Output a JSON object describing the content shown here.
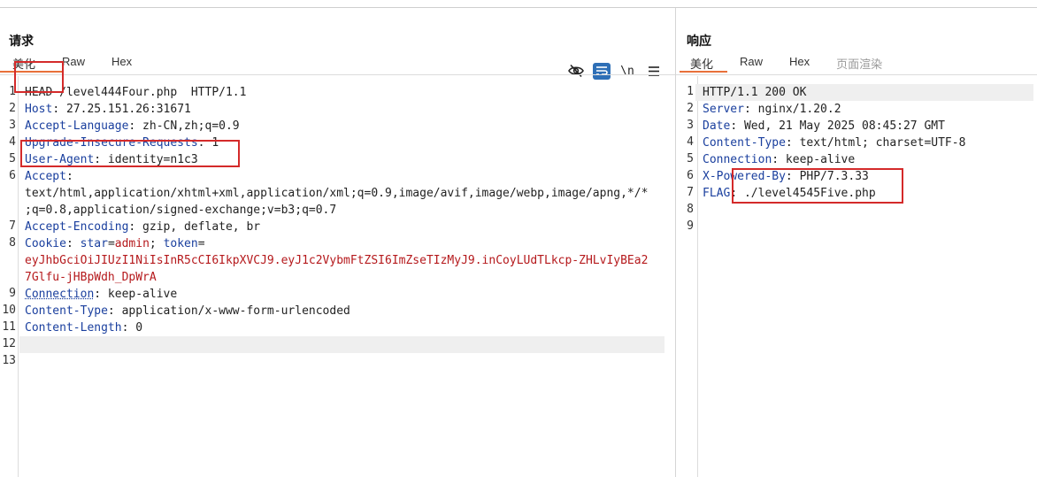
{
  "request": {
    "title": "请求",
    "tabs": [
      "美化",
      "Raw",
      "Hex"
    ],
    "icons": [
      "eye-off-icon",
      "wrap-icon",
      "newline-icon",
      "menu-icon"
    ],
    "newline_label": "\\n",
    "lines": [
      {
        "n": "1",
        "key": "",
        "text": "HEAD /level444Four.php  HTTP/1.1"
      },
      {
        "n": "2",
        "key": "Host",
        "text": ": 27.25.151.26:31671"
      },
      {
        "n": "3",
        "key": "Accept-Language",
        "text": ": zh-CN,zh;q=0.9"
      },
      {
        "n": "4",
        "key": "Upgrade-Insecure-Requests",
        "text": ": 1"
      },
      {
        "n": "5",
        "key": "User-Agent",
        "text": ": identity=n1c3"
      },
      {
        "n": "6",
        "key": "Accept",
        "text": ":"
      },
      {
        "n": "",
        "key": "",
        "text": "text/html,application/xhtml+xml,application/xml;q=0.9,image/avif,image/webp,image/apng,*/*"
      },
      {
        "n": "",
        "key": "",
        "text": ";q=0.8,application/signed-exchange;v=b3;q=0.7"
      },
      {
        "n": "7",
        "key": "Accept-Encoding",
        "text": ": gzip, deflate, br"
      },
      {
        "n": "8",
        "key": "Cookie",
        "text": ": "
      },
      {
        "n": "",
        "key": "",
        "text": ""
      },
      {
        "n": "",
        "key": "",
        "text": ""
      },
      {
        "n": "9",
        "key": "Connection",
        "text": ": keep-alive"
      },
      {
        "n": "10",
        "key": "Content-Type",
        "text": ": application/x-www-form-urlencoded"
      },
      {
        "n": "11",
        "key": "Content-Length",
        "text": ": 0"
      },
      {
        "n": "12",
        "key": "",
        "text": ""
      },
      {
        "n": "13",
        "key": "",
        "text": ""
      }
    ],
    "cookie": {
      "name1": "star",
      "value1": "admin",
      "name2": "token",
      "token_line1": "eyJhbGciOiJIUzI1NiIsInR5cCI6IkpXVCJ9.eyJ1c2VybmFtZSI6ImZseTIzMyJ9.inCoyLUdTLkcp-ZHLvIyBEa2",
      "token_line2": "7Glfu-jHBpWdh_DpWrA"
    }
  },
  "response": {
    "title": "响应",
    "tabs": [
      "美化",
      "Raw",
      "Hex",
      "页面渲染"
    ],
    "lines": [
      {
        "n": "1",
        "key": "",
        "text": "HTTP/1.1 200 OK"
      },
      {
        "n": "2",
        "key": "Server",
        "text": ": nginx/1.20.2"
      },
      {
        "n": "3",
        "key": "Date",
        "text": ": Wed, 21 May 2025 08:45:27 GMT"
      },
      {
        "n": "4",
        "key": "Content-Type",
        "text": ": text/html; charset=UTF-8"
      },
      {
        "n": "5",
        "key": "Connection",
        "text": ": keep-alive"
      },
      {
        "n": "6",
        "key": "X-Powered-By",
        "text": ": PHP/7.3.33"
      },
      {
        "n": "7",
        "key": "FLAG",
        "text": ": ./level4545Five.php"
      },
      {
        "n": "8",
        "key": "",
        "text": ""
      },
      {
        "n": "9",
        "key": "",
        "text": ""
      }
    ]
  }
}
